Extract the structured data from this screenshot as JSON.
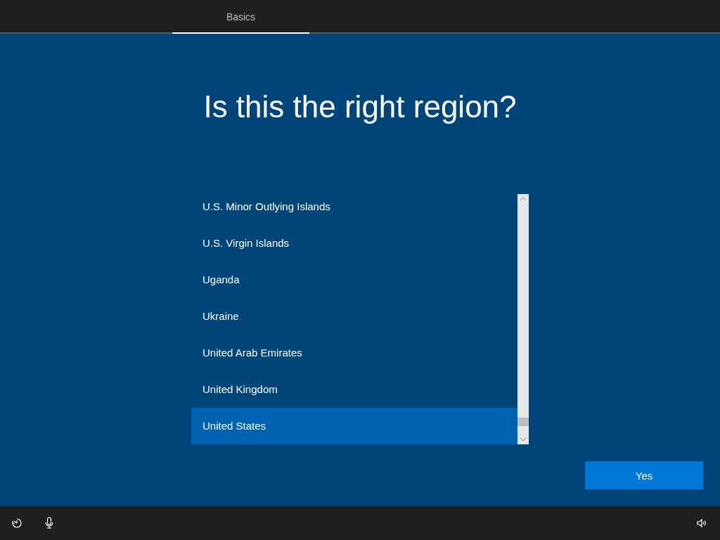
{
  "tabs": [
    {
      "label": "Basics",
      "selected": true
    }
  ],
  "title": "Is this the right region?",
  "regions": [
    {
      "label": "U.S. Minor Outlying Islands",
      "selected": false
    },
    {
      "label": "U.S. Virgin Islands",
      "selected": false
    },
    {
      "label": "Uganda",
      "selected": false
    },
    {
      "label": "Ukraine",
      "selected": false
    },
    {
      "label": "United Arab Emirates",
      "selected": false
    },
    {
      "label": "United Kingdom",
      "selected": false
    },
    {
      "label": "United States",
      "selected": true
    }
  ],
  "buttons": [
    "Yes"
  ]
}
